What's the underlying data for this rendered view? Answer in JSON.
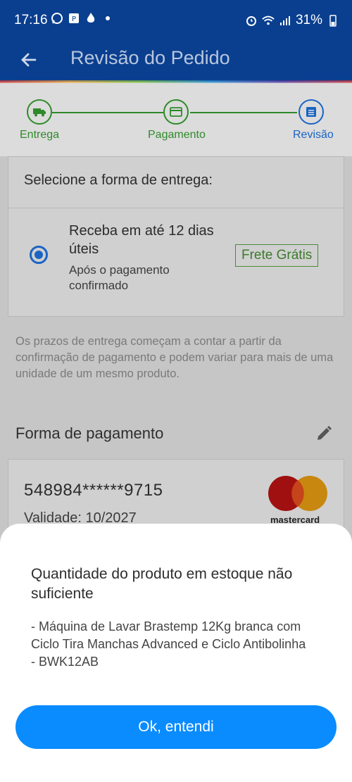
{
  "status_bar": {
    "time": "17:16",
    "battery": "31%",
    "icons": [
      "whatsapp-icon",
      "p-icon",
      "flame-icon",
      "dot-icon",
      "alarm-icon",
      "wifi-icon",
      "signal-icon"
    ]
  },
  "app_bar": {
    "title": "Revisão do Pedido"
  },
  "stepper": {
    "steps": [
      {
        "label": "Entrega",
        "icon": "truck-icon",
        "color": "#2f8a2a"
      },
      {
        "label": "Pagamento",
        "icon": "card-icon",
        "color": "#2f8a2a"
      },
      {
        "label": "Revisão",
        "icon": "list-icon",
        "color": "#1a64c4"
      }
    ]
  },
  "delivery": {
    "heading": "Selecione a forma de entrega:",
    "option_main": "Receba em até 12 dias úteis",
    "option_sub": "Após o pagamento confirmado",
    "badge": "Frete Grátis",
    "note": "Os prazos de entrega começam a contar a partir da confirmação de pagamento e podem variar para mais de uma unidade de um mesmo produto."
  },
  "payment": {
    "title": "Forma de pagamento",
    "card_number": "548984******9715",
    "validity": "Validade: 10/2027",
    "brand": "mastercard"
  },
  "dialog": {
    "title": "Quantidade do produto em estoque não suficiente",
    "body": "- Máquina de Lavar Brastemp 12Kg branca com Ciclo Tira Manchas Advanced e Ciclo Antibolinha - BWK12AB",
    "button": "Ok, entendi",
    "button_color": "#0a8cff"
  }
}
